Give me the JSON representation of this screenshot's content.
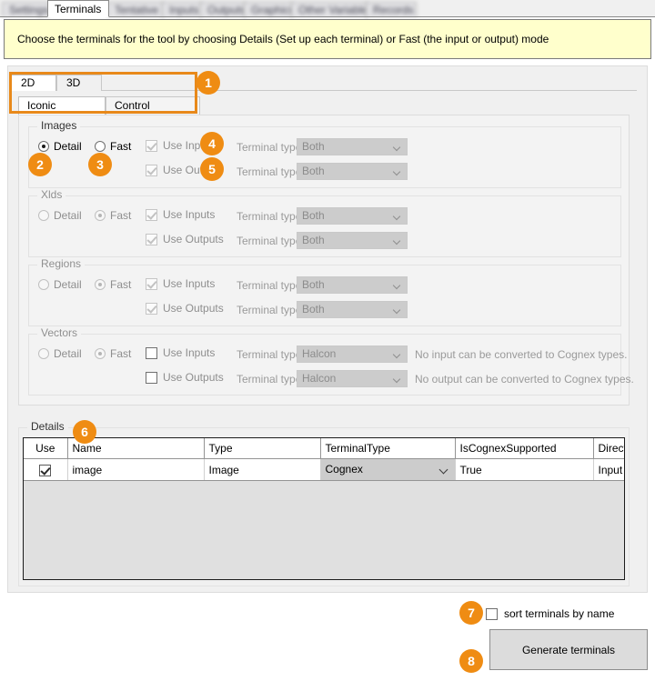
{
  "window": {
    "top_tabs": [
      {
        "label": "Settings",
        "active": false,
        "blurred": true
      },
      {
        "label": "Terminals",
        "active": true,
        "blurred": false
      },
      {
        "label": "Tentative",
        "active": false,
        "blurred": true
      },
      {
        "label": "Inputs",
        "active": false,
        "blurred": true
      },
      {
        "label": "Outputs",
        "active": false,
        "blurred": true
      },
      {
        "label": "Graphics",
        "active": false,
        "blurred": true
      },
      {
        "label": "Other Variables",
        "active": false,
        "blurred": true
      },
      {
        "label": "Records",
        "active": false,
        "blurred": true
      }
    ]
  },
  "banner": {
    "text": "Choose the terminals for the tool by choosing Details (Set up each terminal) or Fast (the input or output) mode"
  },
  "dimension_tabs": [
    {
      "label": "2D",
      "selected": true
    },
    {
      "label": "3D",
      "selected": false
    }
  ],
  "variable_tabs": [
    {
      "label": "Iconic Variables",
      "selected": true
    },
    {
      "label": "Control Variables",
      "selected": false
    }
  ],
  "groups": [
    {
      "title": "Images",
      "enabled": true,
      "detail_label": "Detail",
      "fast_label": "Fast",
      "detail_selected": true,
      "fast_selected": false,
      "rows": [
        {
          "use_label": "Use Inputs",
          "use_checked": true,
          "terminal_type_label": "Terminal type:",
          "terminal_type_value": "Both",
          "hint": ""
        },
        {
          "use_label": "Use Outputs",
          "use_checked": true,
          "terminal_type_label": "Terminal type:",
          "terminal_type_value": "Both",
          "hint": ""
        }
      ]
    },
    {
      "title": "Xlds",
      "enabled": false,
      "detail_label": "Detail",
      "fast_label": "Fast",
      "detail_selected": false,
      "fast_selected": true,
      "rows": [
        {
          "use_label": "Use Inputs",
          "use_checked": true,
          "terminal_type_label": "Terminal type:",
          "terminal_type_value": "Both",
          "hint": ""
        },
        {
          "use_label": "Use Outputs",
          "use_checked": true,
          "terminal_type_label": "Terminal type:",
          "terminal_type_value": "Both",
          "hint": ""
        }
      ]
    },
    {
      "title": "Regions",
      "enabled": false,
      "detail_label": "Detail",
      "fast_label": "Fast",
      "detail_selected": false,
      "fast_selected": true,
      "rows": [
        {
          "use_label": "Use Inputs",
          "use_checked": true,
          "terminal_type_label": "Terminal type:",
          "terminal_type_value": "Both",
          "hint": ""
        },
        {
          "use_label": "Use Outputs",
          "use_checked": true,
          "terminal_type_label": "Terminal type:",
          "terminal_type_value": "Both",
          "hint": ""
        }
      ]
    },
    {
      "title": "Vectors",
      "enabled": false,
      "detail_label": "Detail",
      "fast_label": "Fast",
      "detail_selected": false,
      "fast_selected": true,
      "rows": [
        {
          "use_label": "Use Inputs",
          "use_checked": false,
          "terminal_type_label": "Terminal type:",
          "terminal_type_value": "Halcon",
          "hint": "No input can be converted to Cognex types."
        },
        {
          "use_label": "Use Outputs",
          "use_checked": false,
          "terminal_type_label": "Terminal type:",
          "terminal_type_value": "Halcon",
          "hint": "No output can be converted to Cognex types."
        }
      ]
    }
  ],
  "details": {
    "title": "Details",
    "columns": [
      "Use",
      "Name",
      "Type",
      "TerminalType",
      "IsCognexSupported",
      "Direction"
    ],
    "rows": [
      {
        "use": true,
        "name": "image",
        "type": "Image",
        "terminal_type": "Cognex",
        "is_cognex_supported": "True",
        "direction": "Input"
      }
    ]
  },
  "footer": {
    "sort_label": "sort terminals by name",
    "sort_checked": false,
    "generate_label": "Generate terminals"
  },
  "annotations": {
    "badges": [
      "1",
      "2",
      "3",
      "4",
      "5",
      "6",
      "7",
      "8"
    ],
    "accent_color": "#ef8c13"
  }
}
